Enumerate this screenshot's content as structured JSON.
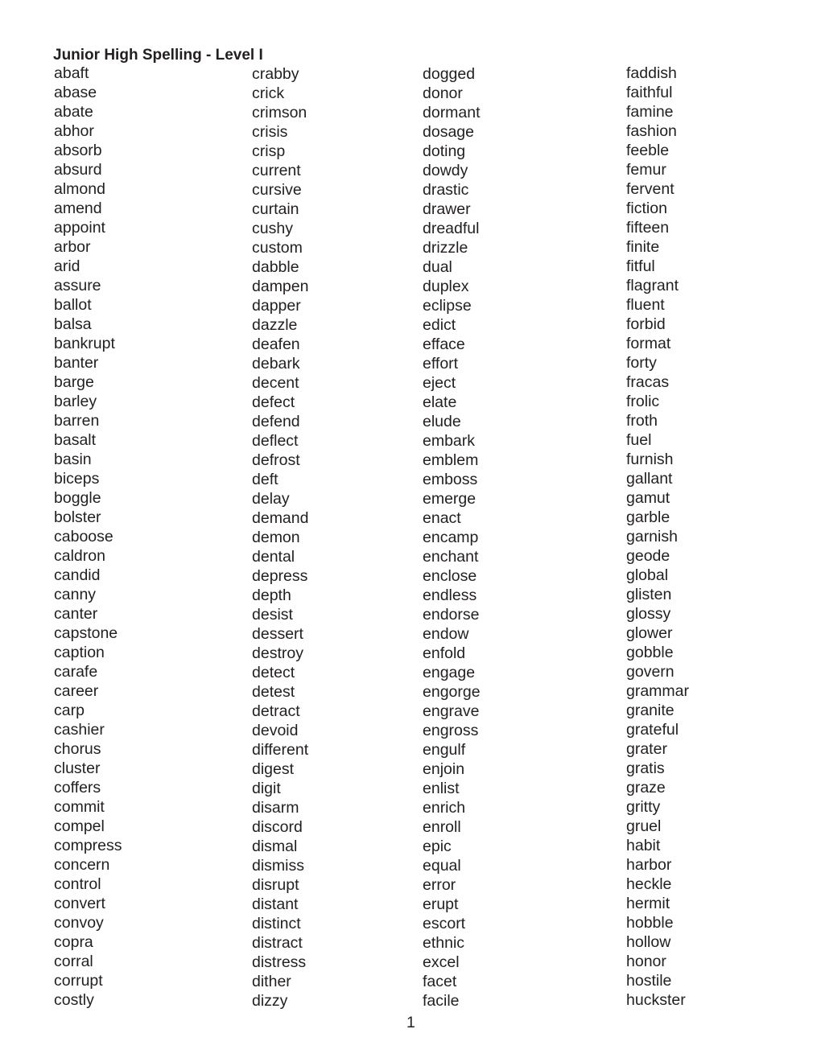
{
  "document": {
    "title": "Junior High Spelling - Level I",
    "page_number": "1"
  },
  "columns": [
    [
      "abaft",
      "abase",
      "abate",
      "abhor",
      "absorb",
      "absurd",
      "almond",
      "amend",
      "appoint",
      "arbor",
      "arid",
      "assure",
      "ballot",
      "balsa",
      "bankrupt",
      "banter",
      "barge",
      "barley",
      "barren",
      "basalt",
      "basin",
      "biceps",
      "boggle",
      "bolster",
      "caboose",
      "caldron",
      "candid",
      "canny",
      "canter",
      "capstone",
      "caption",
      "carafe",
      "career",
      "carp",
      "cashier",
      "chorus",
      "cluster",
      "coffers",
      "commit",
      "compel",
      "compress",
      "concern",
      "control",
      "convert",
      "convoy",
      "copra",
      "corral",
      "corrupt",
      "costly"
    ],
    [
      "crabby",
      "crick",
      "crimson",
      "crisis",
      "crisp",
      "current",
      "cursive",
      "curtain",
      "cushy",
      "custom",
      "dabble",
      "dampen",
      "dapper",
      "dazzle",
      "deafen",
      "debark",
      "decent",
      "defect",
      "defend",
      "deflect",
      "defrost",
      "deft",
      "delay",
      "demand",
      "demon",
      "dental",
      "depress",
      "depth",
      "desist",
      "dessert",
      "destroy",
      "detect",
      "detest",
      "detract",
      "devoid",
      "different",
      "digest",
      "digit",
      "disarm",
      "discord",
      "dismal",
      "dismiss",
      "disrupt",
      "distant",
      "distinct",
      "distract",
      "distress",
      "dither",
      "dizzy"
    ],
    [
      "dogged",
      "donor",
      "dormant",
      "dosage",
      "doting",
      "dowdy",
      "drastic",
      "drawer",
      "dreadful",
      "drizzle",
      "dual",
      "duplex",
      "eclipse",
      "edict",
      "efface",
      "effort",
      "eject",
      "elate",
      "elude",
      "embark",
      "emblem",
      "emboss",
      "emerge",
      "enact",
      "encamp",
      "enchant",
      "enclose",
      "endless",
      "endorse",
      "endow",
      "enfold",
      "engage",
      "engorge",
      "engrave",
      "engross",
      "engulf",
      "enjoin",
      "enlist",
      "enrich",
      "enroll",
      "epic",
      "equal",
      "error",
      "erupt",
      "escort",
      "ethnic",
      "excel",
      "facet",
      "facile"
    ],
    [
      "faddish",
      "faithful",
      "famine",
      "fashion",
      "feeble",
      "femur",
      "fervent",
      "fiction",
      "fifteen",
      "finite",
      "fitful",
      "flagrant",
      "fluent",
      "forbid",
      "format",
      "forty",
      "fracas",
      "frolic",
      "froth",
      "fuel",
      "furnish",
      "gallant",
      "gamut",
      "garble",
      "garnish",
      "geode",
      "global",
      "glisten",
      "glossy",
      "glower",
      "gobble",
      "govern",
      "grammar",
      "granite",
      "grateful",
      "grater",
      "gratis",
      "graze",
      "gritty",
      "gruel",
      "habit",
      "harbor",
      "heckle",
      "hermit",
      "hobble",
      "hollow",
      "honor",
      "hostile",
      "huckster"
    ]
  ]
}
